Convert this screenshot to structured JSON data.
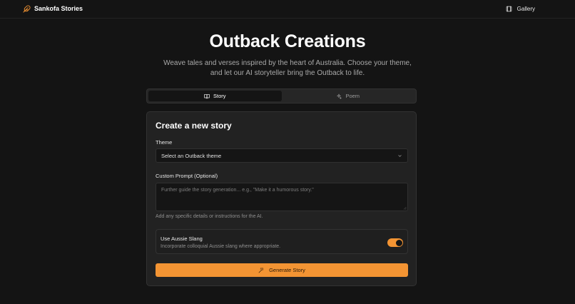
{
  "nav": {
    "brand": "Sankofa Stories",
    "gallery_label": "Gallery"
  },
  "hero": {
    "title": "Outback Creations",
    "subtitle": "Weave tales and verses inspired by the heart of Australia. Choose your theme, and let our AI storyteller bring the Outback to life."
  },
  "tabs": [
    {
      "label": "Story",
      "icon": "book-open-icon",
      "active": true
    },
    {
      "label": "Poem",
      "icon": "sparkles-icon",
      "active": false
    }
  ],
  "form": {
    "title": "Create a new story",
    "theme_label": "Theme",
    "theme_placeholder": "Select an Outback theme",
    "prompt_label": "Custom Prompt (Optional)",
    "prompt_placeholder": "Further guide the story generation... e.g., \"Make it a humorous story.\"",
    "prompt_help": "Add any specific details or instructions for the AI.",
    "slang_title": "Use Aussie Slang",
    "slang_description": "Incorporate colloquial Aussie slang where appropriate.",
    "slang_enabled": true,
    "generate_label": "Generate Story"
  },
  "colors": {
    "accent": "#f39433",
    "background": "#141414",
    "card": "#222222"
  }
}
